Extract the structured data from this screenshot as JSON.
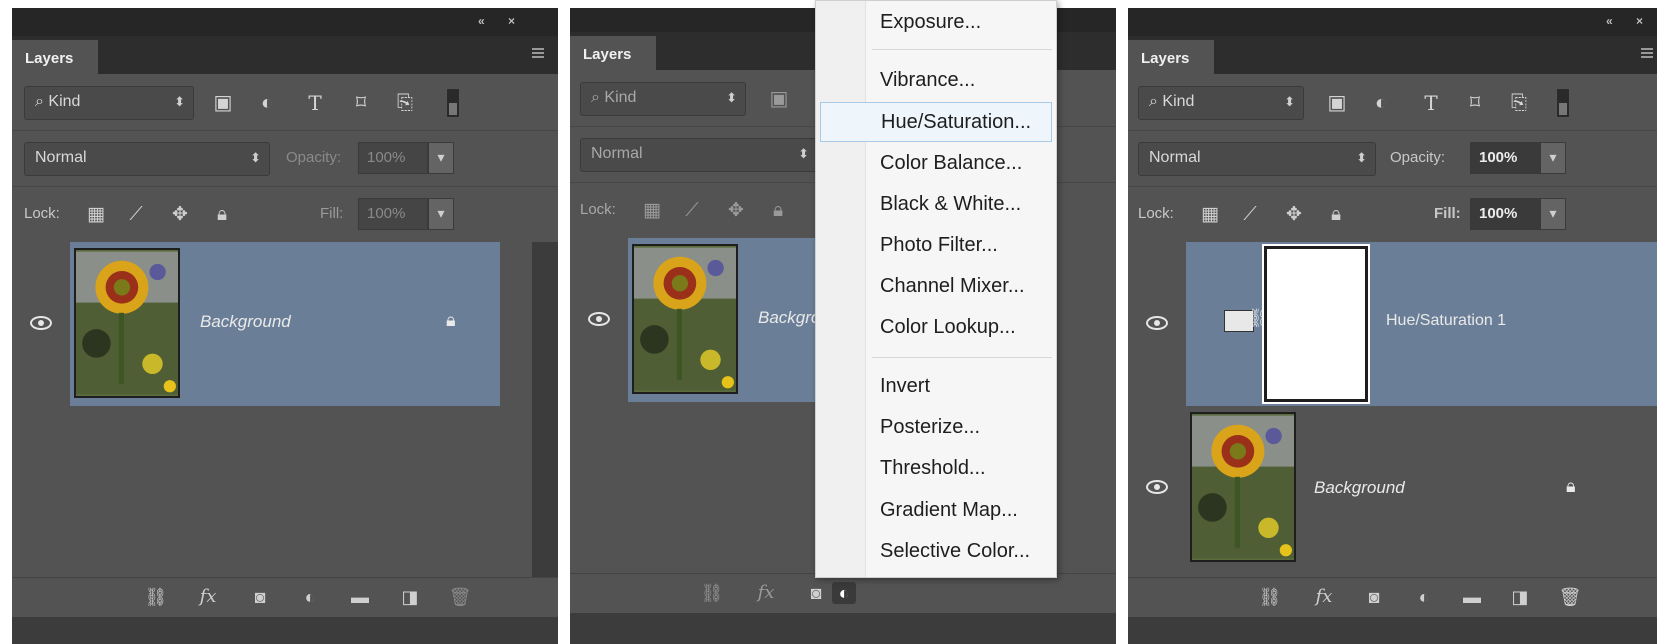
{
  "colors": {
    "panel_bg": "#535353",
    "panel_dark": "#3c3c3c",
    "selected_layer": "#6a7f97",
    "menu_bg": "#f6f6f6",
    "menu_highlight": "#eef5fb"
  },
  "panels": [
    {
      "tab": "Layers",
      "filter": "Kind",
      "blend_mode": "Normal",
      "opacity_label": "Opacity:",
      "opacity_value": "100%",
      "lock_label": "Lock:",
      "fill_label": "Fill:",
      "fill_value": "100%",
      "layers": [
        {
          "name": "Background",
          "selected": true
        }
      ]
    },
    {
      "tab": "Layers",
      "filter": "Kind",
      "blend_mode": "Normal",
      "lock_label": "Lock:",
      "layers": [
        {
          "name": "Backgrour",
          "selected": true
        }
      ]
    },
    {
      "tab": "Layers",
      "filter": "Kind",
      "blend_mode": "Normal",
      "opacity_label": "Opacity:",
      "opacity_value": "100%",
      "lock_label": "Lock:",
      "fill_label": "Fill:",
      "fill_value": "100%",
      "layers": [
        {
          "name": "Hue/Saturation 1",
          "selected": true
        },
        {
          "name": "Background",
          "selected": false
        }
      ]
    }
  ],
  "adjustment_menu": {
    "items": [
      "Exposure...",
      "Vibrance...",
      "Hue/Saturation...",
      "Color Balance...",
      "Black & White...",
      "Photo Filter...",
      "Channel Mixer...",
      "Color Lookup...",
      "Invert",
      "Posterize...",
      "Threshold...",
      "Gradient Map...",
      "Selective Color..."
    ],
    "highlighted": "Hue/Saturation..."
  },
  "footer_icons": [
    "link-icon",
    "fx-icon",
    "mask-icon",
    "adjustment-icon",
    "folder-icon",
    "new-layer-icon",
    "trash-icon"
  ]
}
